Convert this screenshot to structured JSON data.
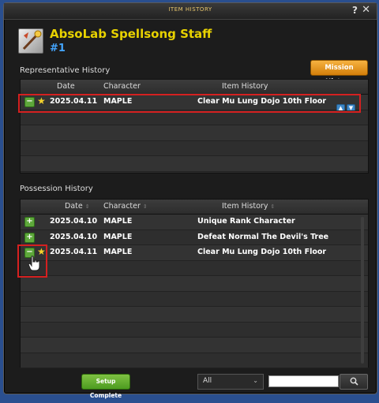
{
  "window": {
    "title": "ITEM HISTORY",
    "help_label": "?",
    "close_label": "✕"
  },
  "item": {
    "name": "AbsoLab Spellsong Staff",
    "number": "#1",
    "icon": "staff-icon"
  },
  "representative": {
    "label": "Representative History",
    "mission_button": "Mission History",
    "columns": {
      "date": "Date",
      "character": "Character",
      "history": "Item History"
    },
    "rows": [
      {
        "date": "2025.04.11",
        "character": "MAPLE",
        "history": "Clear Mu Lung Dojo 10th Floor"
      }
    ]
  },
  "possession": {
    "label": "Possession History",
    "columns": {
      "date": "Date",
      "character": "Character",
      "history": "Item History"
    },
    "rows": [
      {
        "date": "2025.04.10",
        "character": "MAPLE",
        "history": "Unique Rank Character"
      },
      {
        "date": "2025.04.10",
        "character": "MAPLE",
        "history": "Defeat Normal The Devil's Tree"
      },
      {
        "date": "2025.04.11",
        "character": "MAPLE",
        "history": "Clear Mu Lung Dojo 10th Floor"
      }
    ]
  },
  "footer": {
    "setup_button": "Setup Complete",
    "filter_value": "All",
    "search_value": "",
    "search_icon": "search-icon"
  },
  "colors": {
    "accent_orange": "#e89a1f",
    "accent_green": "#5ea83b",
    "title_yellow": "#e8d200",
    "highlight_red": "#d42020"
  }
}
